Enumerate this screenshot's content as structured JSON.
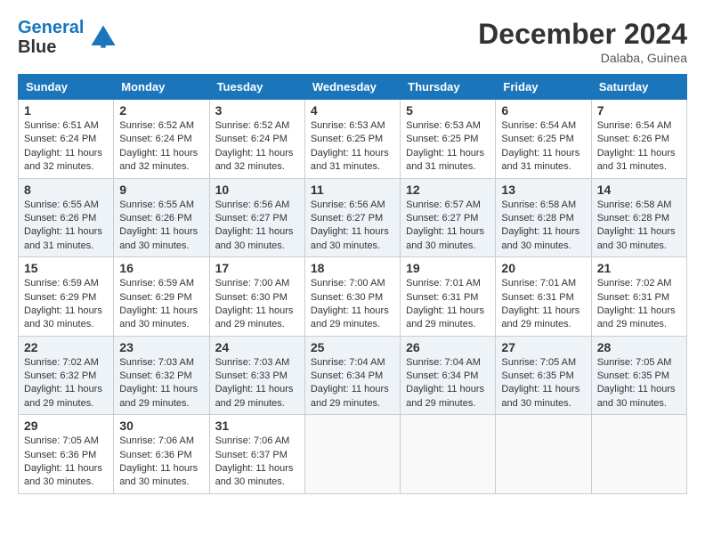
{
  "header": {
    "logo_line1": "General",
    "logo_line2": "Blue",
    "month_year": "December 2024",
    "location": "Dalaba, Guinea"
  },
  "weekdays": [
    "Sunday",
    "Monday",
    "Tuesday",
    "Wednesday",
    "Thursday",
    "Friday",
    "Saturday"
  ],
  "weeks": [
    [
      {
        "day": "1",
        "sunrise": "6:51 AM",
        "sunset": "6:24 PM",
        "daylight": "11 hours and 32 minutes."
      },
      {
        "day": "2",
        "sunrise": "6:52 AM",
        "sunset": "6:24 PM",
        "daylight": "11 hours and 32 minutes."
      },
      {
        "day": "3",
        "sunrise": "6:52 AM",
        "sunset": "6:24 PM",
        "daylight": "11 hours and 32 minutes."
      },
      {
        "day": "4",
        "sunrise": "6:53 AM",
        "sunset": "6:25 PM",
        "daylight": "11 hours and 31 minutes."
      },
      {
        "day": "5",
        "sunrise": "6:53 AM",
        "sunset": "6:25 PM",
        "daylight": "11 hours and 31 minutes."
      },
      {
        "day": "6",
        "sunrise": "6:54 AM",
        "sunset": "6:25 PM",
        "daylight": "11 hours and 31 minutes."
      },
      {
        "day": "7",
        "sunrise": "6:54 AM",
        "sunset": "6:26 PM",
        "daylight": "11 hours and 31 minutes."
      }
    ],
    [
      {
        "day": "8",
        "sunrise": "6:55 AM",
        "sunset": "6:26 PM",
        "daylight": "11 hours and 31 minutes."
      },
      {
        "day": "9",
        "sunrise": "6:55 AM",
        "sunset": "6:26 PM",
        "daylight": "11 hours and 30 minutes."
      },
      {
        "day": "10",
        "sunrise": "6:56 AM",
        "sunset": "6:27 PM",
        "daylight": "11 hours and 30 minutes."
      },
      {
        "day": "11",
        "sunrise": "6:56 AM",
        "sunset": "6:27 PM",
        "daylight": "11 hours and 30 minutes."
      },
      {
        "day": "12",
        "sunrise": "6:57 AM",
        "sunset": "6:27 PM",
        "daylight": "11 hours and 30 minutes."
      },
      {
        "day": "13",
        "sunrise": "6:58 AM",
        "sunset": "6:28 PM",
        "daylight": "11 hours and 30 minutes."
      },
      {
        "day": "14",
        "sunrise": "6:58 AM",
        "sunset": "6:28 PM",
        "daylight": "11 hours and 30 minutes."
      }
    ],
    [
      {
        "day": "15",
        "sunrise": "6:59 AM",
        "sunset": "6:29 PM",
        "daylight": "11 hours and 30 minutes."
      },
      {
        "day": "16",
        "sunrise": "6:59 AM",
        "sunset": "6:29 PM",
        "daylight": "11 hours and 30 minutes."
      },
      {
        "day": "17",
        "sunrise": "7:00 AM",
        "sunset": "6:30 PM",
        "daylight": "11 hours and 29 minutes."
      },
      {
        "day": "18",
        "sunrise": "7:00 AM",
        "sunset": "6:30 PM",
        "daylight": "11 hours and 29 minutes."
      },
      {
        "day": "19",
        "sunrise": "7:01 AM",
        "sunset": "6:31 PM",
        "daylight": "11 hours and 29 minutes."
      },
      {
        "day": "20",
        "sunrise": "7:01 AM",
        "sunset": "6:31 PM",
        "daylight": "11 hours and 29 minutes."
      },
      {
        "day": "21",
        "sunrise": "7:02 AM",
        "sunset": "6:31 PM",
        "daylight": "11 hours and 29 minutes."
      }
    ],
    [
      {
        "day": "22",
        "sunrise": "7:02 AM",
        "sunset": "6:32 PM",
        "daylight": "11 hours and 29 minutes."
      },
      {
        "day": "23",
        "sunrise": "7:03 AM",
        "sunset": "6:32 PM",
        "daylight": "11 hours and 29 minutes."
      },
      {
        "day": "24",
        "sunrise": "7:03 AM",
        "sunset": "6:33 PM",
        "daylight": "11 hours and 29 minutes."
      },
      {
        "day": "25",
        "sunrise": "7:04 AM",
        "sunset": "6:34 PM",
        "daylight": "11 hours and 29 minutes."
      },
      {
        "day": "26",
        "sunrise": "7:04 AM",
        "sunset": "6:34 PM",
        "daylight": "11 hours and 29 minutes."
      },
      {
        "day": "27",
        "sunrise": "7:05 AM",
        "sunset": "6:35 PM",
        "daylight": "11 hours and 30 minutes."
      },
      {
        "day": "28",
        "sunrise": "7:05 AM",
        "sunset": "6:35 PM",
        "daylight": "11 hours and 30 minutes."
      }
    ],
    [
      {
        "day": "29",
        "sunrise": "7:05 AM",
        "sunset": "6:36 PM",
        "daylight": "11 hours and 30 minutes."
      },
      {
        "day": "30",
        "sunrise": "7:06 AM",
        "sunset": "6:36 PM",
        "daylight": "11 hours and 30 minutes."
      },
      {
        "day": "31",
        "sunrise": "7:06 AM",
        "sunset": "6:37 PM",
        "daylight": "11 hours and 30 minutes."
      },
      null,
      null,
      null,
      null
    ]
  ]
}
